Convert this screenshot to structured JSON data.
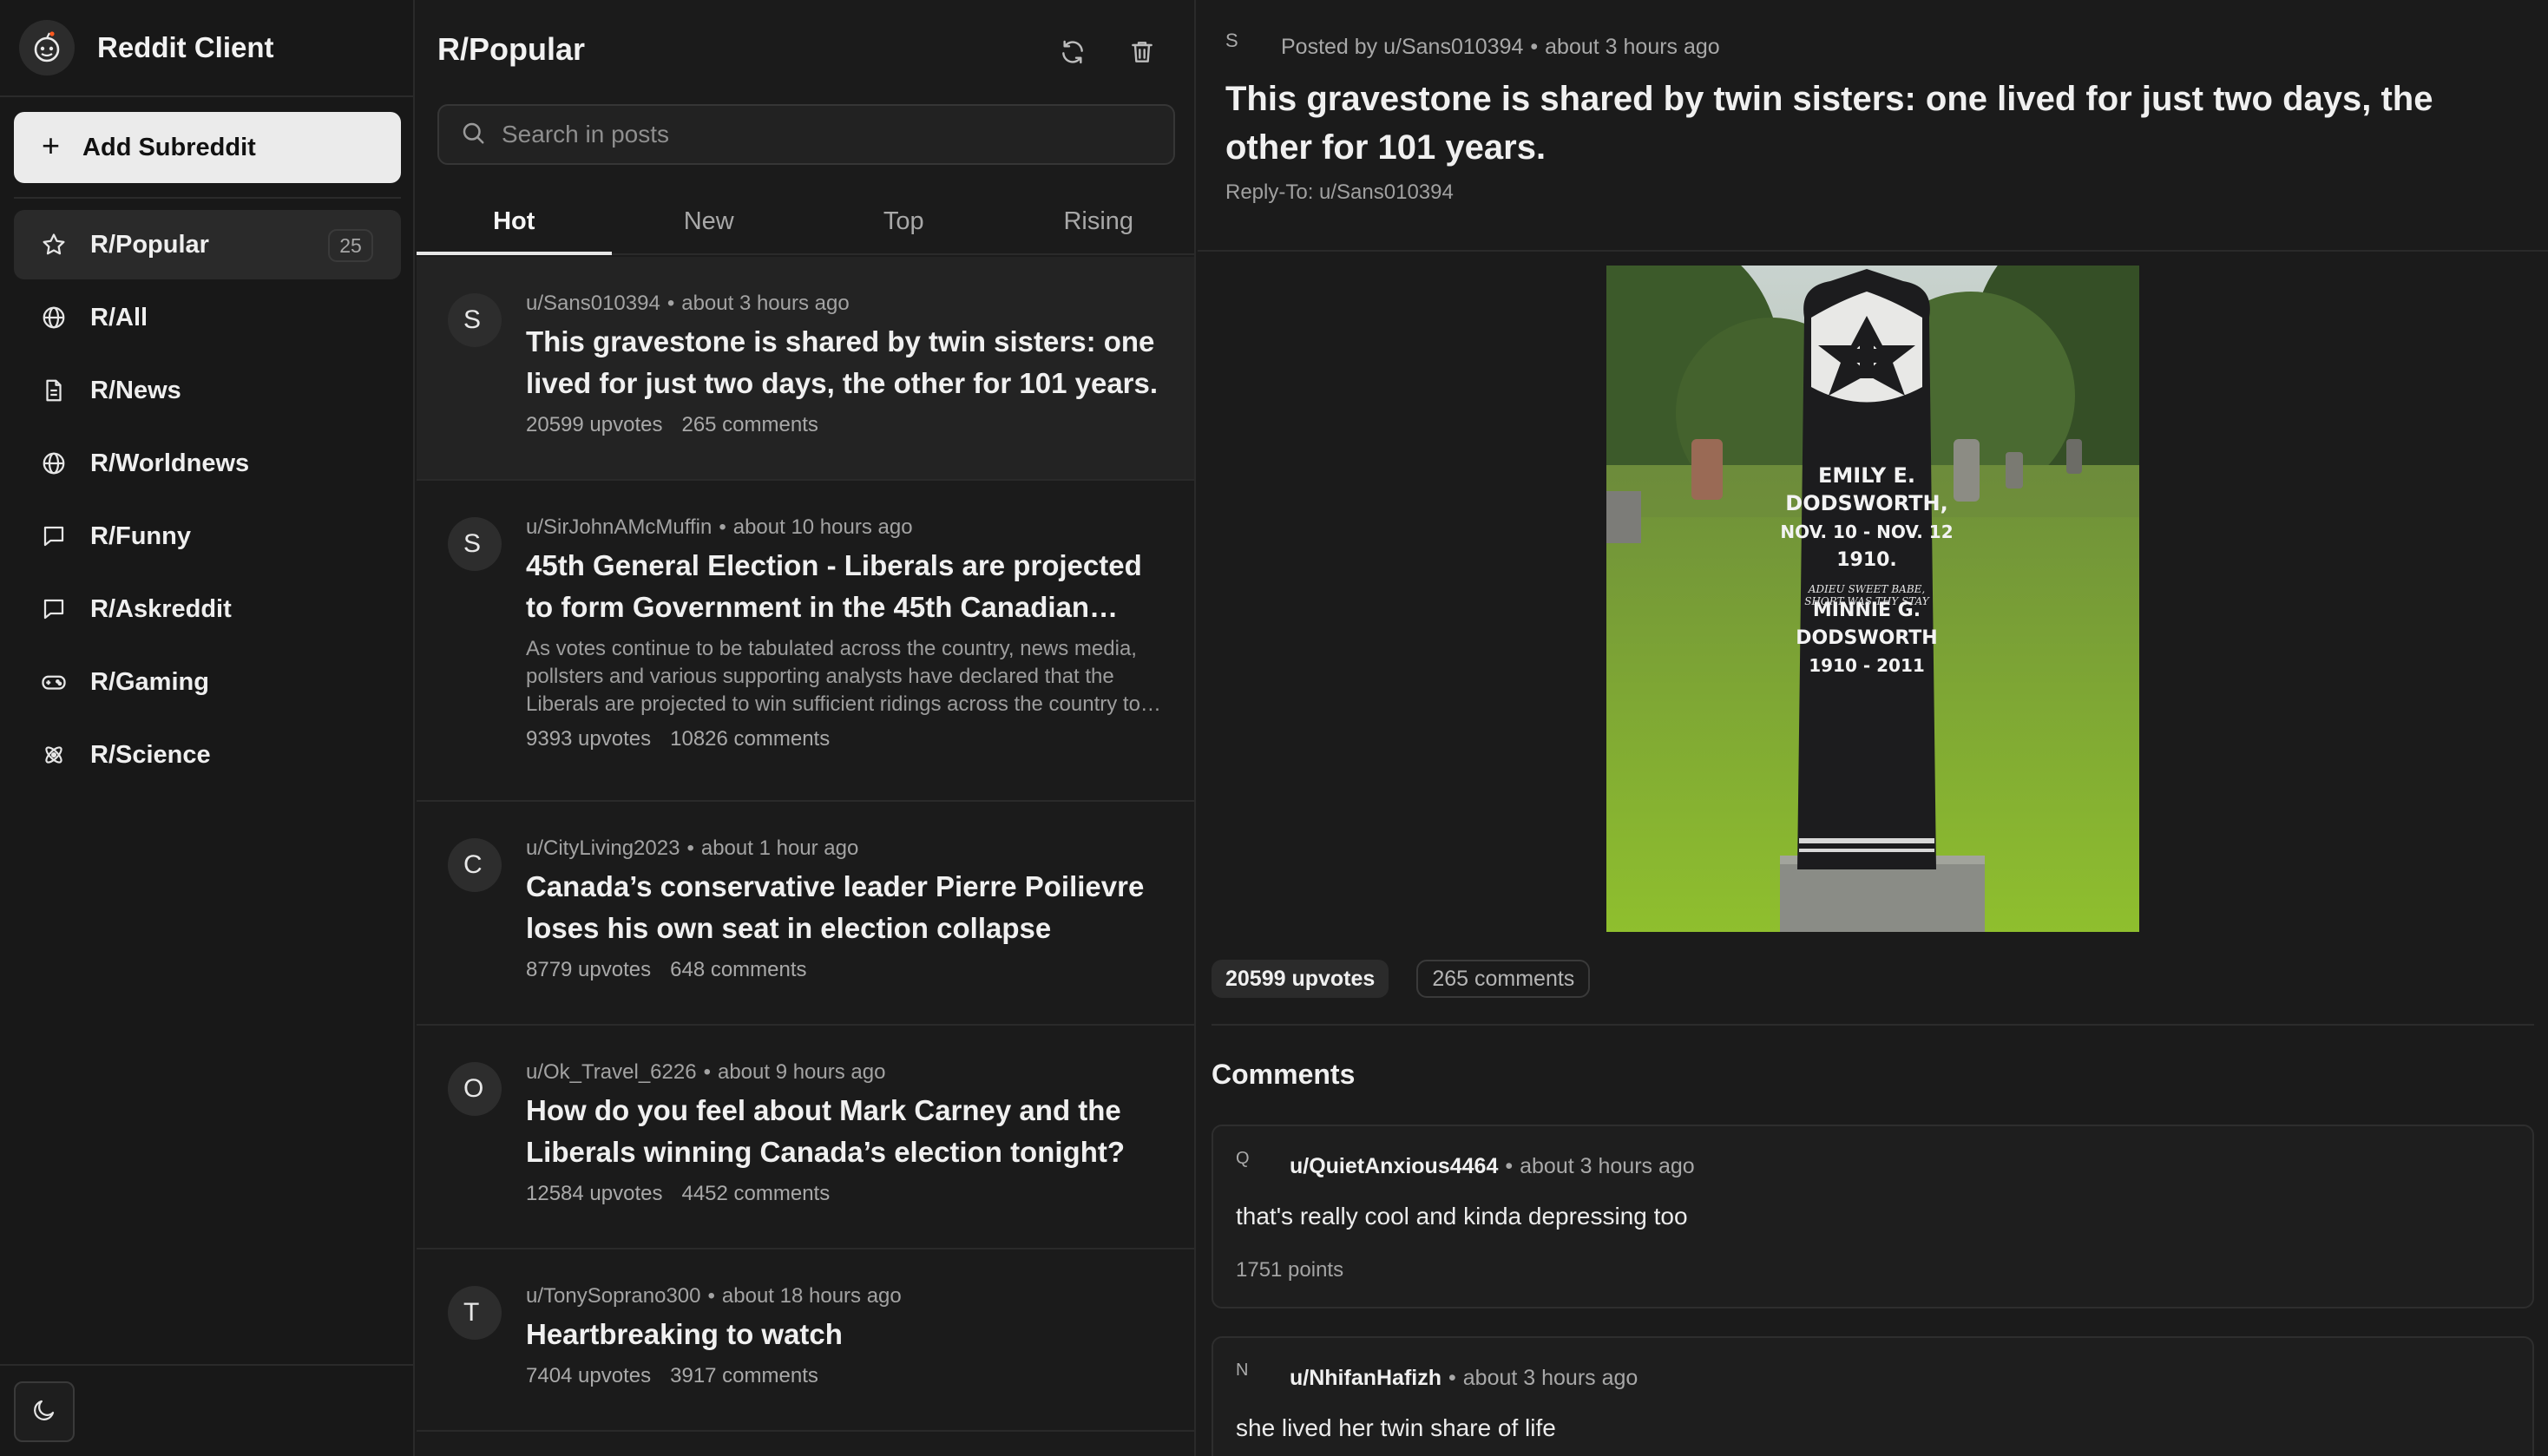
{
  "app": {
    "title": "Reddit Client"
  },
  "sidebar": {
    "add_label": "Add Subreddit",
    "items": [
      {
        "label": "R/Popular",
        "icon": "star-icon",
        "count": "25",
        "active": true
      },
      {
        "label": "R/All",
        "icon": "globe-icon"
      },
      {
        "label": "R/News",
        "icon": "document-icon"
      },
      {
        "label": "R/Worldnews",
        "icon": "globe-icon"
      },
      {
        "label": "R/Funny",
        "icon": "chat-bubble-icon"
      },
      {
        "label": "R/Askreddit",
        "icon": "chat-bubble-icon"
      },
      {
        "label": "R/Gaming",
        "icon": "gamepad-icon"
      },
      {
        "label": "R/Science",
        "icon": "atom-icon"
      }
    ]
  },
  "list": {
    "title": "R/Popular",
    "search_placeholder": "Search in posts",
    "tabs": [
      "Hot",
      "New",
      "Top",
      "Rising"
    ],
    "active_tab": "Hot",
    "posts": [
      {
        "avatar": "S",
        "author": "u/Sans010394",
        "time": "about 3 hours ago",
        "title": "This gravestone is shared by twin sisters: one lived for just two days, the other for 101 years.",
        "upvotes": "20599 upvotes",
        "comments": "265 comments"
      },
      {
        "avatar": "S",
        "author": "u/SirJohnAMcMuffin",
        "time": "about 10 hours ago",
        "title": "45th General Election - Liberals are projected to form Government in the 45th Canadian Parliament",
        "excerpt": "As votes continue to be tabulated across the country, news media, pollsters and various supporting analysts have declared that the Liberals are projected to win sufficient ridings across the country to form government.",
        "upvotes": "9393 upvotes",
        "comments": "10826 comments"
      },
      {
        "avatar": "C",
        "author": "u/CityLiving2023",
        "time": "about 1 hour ago",
        "title": "Canada’s conservative leader Pierre Poilievre loses his own seat in election collapse",
        "upvotes": "8779 upvotes",
        "comments": "648 comments"
      },
      {
        "avatar": "O",
        "author": "u/Ok_Travel_6226",
        "time": "about 9 hours ago",
        "title": "How do you feel about Mark Carney and the Liberals winning Canada’s election tonight?",
        "upvotes": "12584 upvotes",
        "comments": "4452 comments"
      },
      {
        "avatar": "T",
        "author": "u/TonySoprano300",
        "time": "about 18 hours ago",
        "title": "Heartbreaking to watch",
        "upvotes": "7404 upvotes",
        "comments": "3917 comments"
      }
    ]
  },
  "detail": {
    "avatar": "S",
    "posted_by": "Posted by u/Sans010394",
    "time": "about 3 hours ago",
    "title": "This gravestone is shared by twin sisters: one lived for just two days, the other for 101 years.",
    "reply_to": "Reply-To: u/Sans010394",
    "image": {
      "line1": "EMILY E.",
      "line2": "DODSWORTH,",
      "line3": "NOV. 10 - NOV. 12",
      "line4": "1910.",
      "verse1": "ADIEU SWEET BABE,",
      "verse2": "SHORT WAS THY STAY",
      "verse3": "JUST LOOKED AROUND",
      "verse4": "THEN CALLED AWAY.",
      "line5": "MINNIE G.",
      "line6": "DODSWORTH",
      "line7": "1910 - 2011"
    },
    "upvotes": "20599 upvotes",
    "comments_count": "265 comments",
    "comments_heading": "Comments",
    "comments": [
      {
        "avatar": "Q",
        "author": "u/QuietAnxious4464",
        "time": "about 3 hours ago",
        "body": "that's really cool and kinda depressing too",
        "points": "1751 points"
      },
      {
        "avatar": "N",
        "author": "u/NhifanHafizh",
        "time": "about 3 hours ago",
        "body": "she lived her twin share of life",
        "points": ""
      }
    ]
  }
}
